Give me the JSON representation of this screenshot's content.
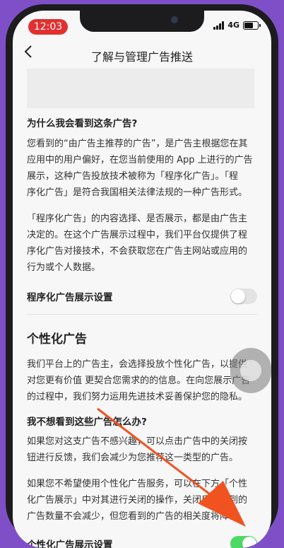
{
  "status_bar": {
    "time": "12:03",
    "network": "4G"
  },
  "nav": {
    "back_icon": "chevron-left-icon",
    "title": "了解与管理广告推送"
  },
  "section1": {
    "heading": "为什么我会看到这条广告?",
    "para1_lines": [
      "您看到的“由广告主推荐的广告”，是广告主根据您在其",
      "应用中的用户偏好，在您当前使用的 App 上进行的广告",
      "展示，这种广告投放技术被称为「程序化广告」。「程",
      "序化广告」是符合我国相关法律法规的一种广告形式。"
    ],
    "para2_lines": [
      "「程序化广告」的内容选择、是否展示，都是由广告主",
      "决定的。在这个广告展示过程中，我们平台仅提供了程",
      "序化广告对接技术，不会获取您在广告主网站或应用的",
      "行为或个人数据。"
    ]
  },
  "setting1": {
    "label": "程序化广告展示设置",
    "enabled": false
  },
  "section2": {
    "title": "个性化广告",
    "para_lines": [
      "我们平台上的广告主，会选择投放个性化广告，以提供",
      "对您更有价值 更契合您需求的的信息。在向您展示广告",
      "的过程中，我们努力运用先进技术妥善保护您的隐私。"
    ],
    "subheading": "我不想看到这些广告怎么办?",
    "para2_lines": [
      "如果您对这支广告不感兴趣，可以点击广告中的关闭按",
      "钮进行反馈，我们会减少为您推荐这一类型的广告。"
    ],
    "para3_lines": [
      "如果您不希望使用个性化广告服务，可以在下方「个性",
      "化广告展示」中对其进行关闭的操作，关闭后您看到的",
      "广告数量不会减少，但您看到的广告的相关度将降低。"
    ]
  },
  "setting2": {
    "label": "个性化广告展示设置",
    "enabled": true
  },
  "colors": {
    "toggle_on": "#4cd964",
    "arrow": "#f0531f",
    "time_pill": "#e2302f"
  }
}
